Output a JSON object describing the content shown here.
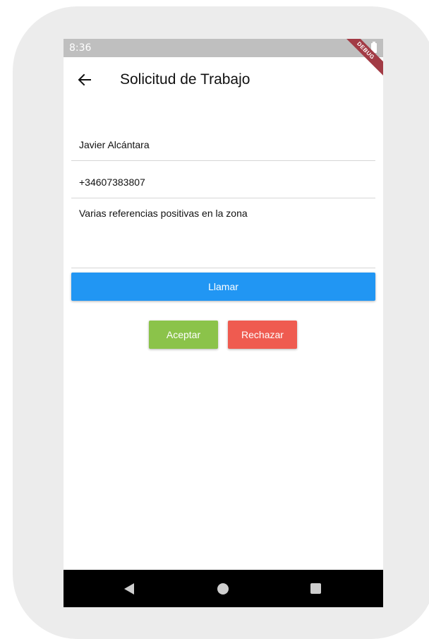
{
  "status_bar": {
    "time": "8:36",
    "debug_label": "DEBUG",
    "battery_icon": "battery-icon"
  },
  "app_bar": {
    "back_icon": "arrow-left-icon",
    "title": "Solicitud de Trabajo"
  },
  "form": {
    "name": "Javier Alcántara",
    "phone": "+34607383807",
    "notes": "Varias referencias positivas en la zona"
  },
  "actions": {
    "call_label": "Llamar",
    "accept_label": "Aceptar",
    "reject_label": "Rechazar"
  },
  "colors": {
    "call": "#2196f3",
    "accept": "#8bc34a",
    "reject": "#ef5b50",
    "status_bar": "#bfbfbf",
    "debug_banner": "#a23b45"
  },
  "nav_bar": {
    "back_icon": "triangle-back-icon",
    "home_icon": "circle-home-icon",
    "recents_icon": "square-recents-icon"
  }
}
